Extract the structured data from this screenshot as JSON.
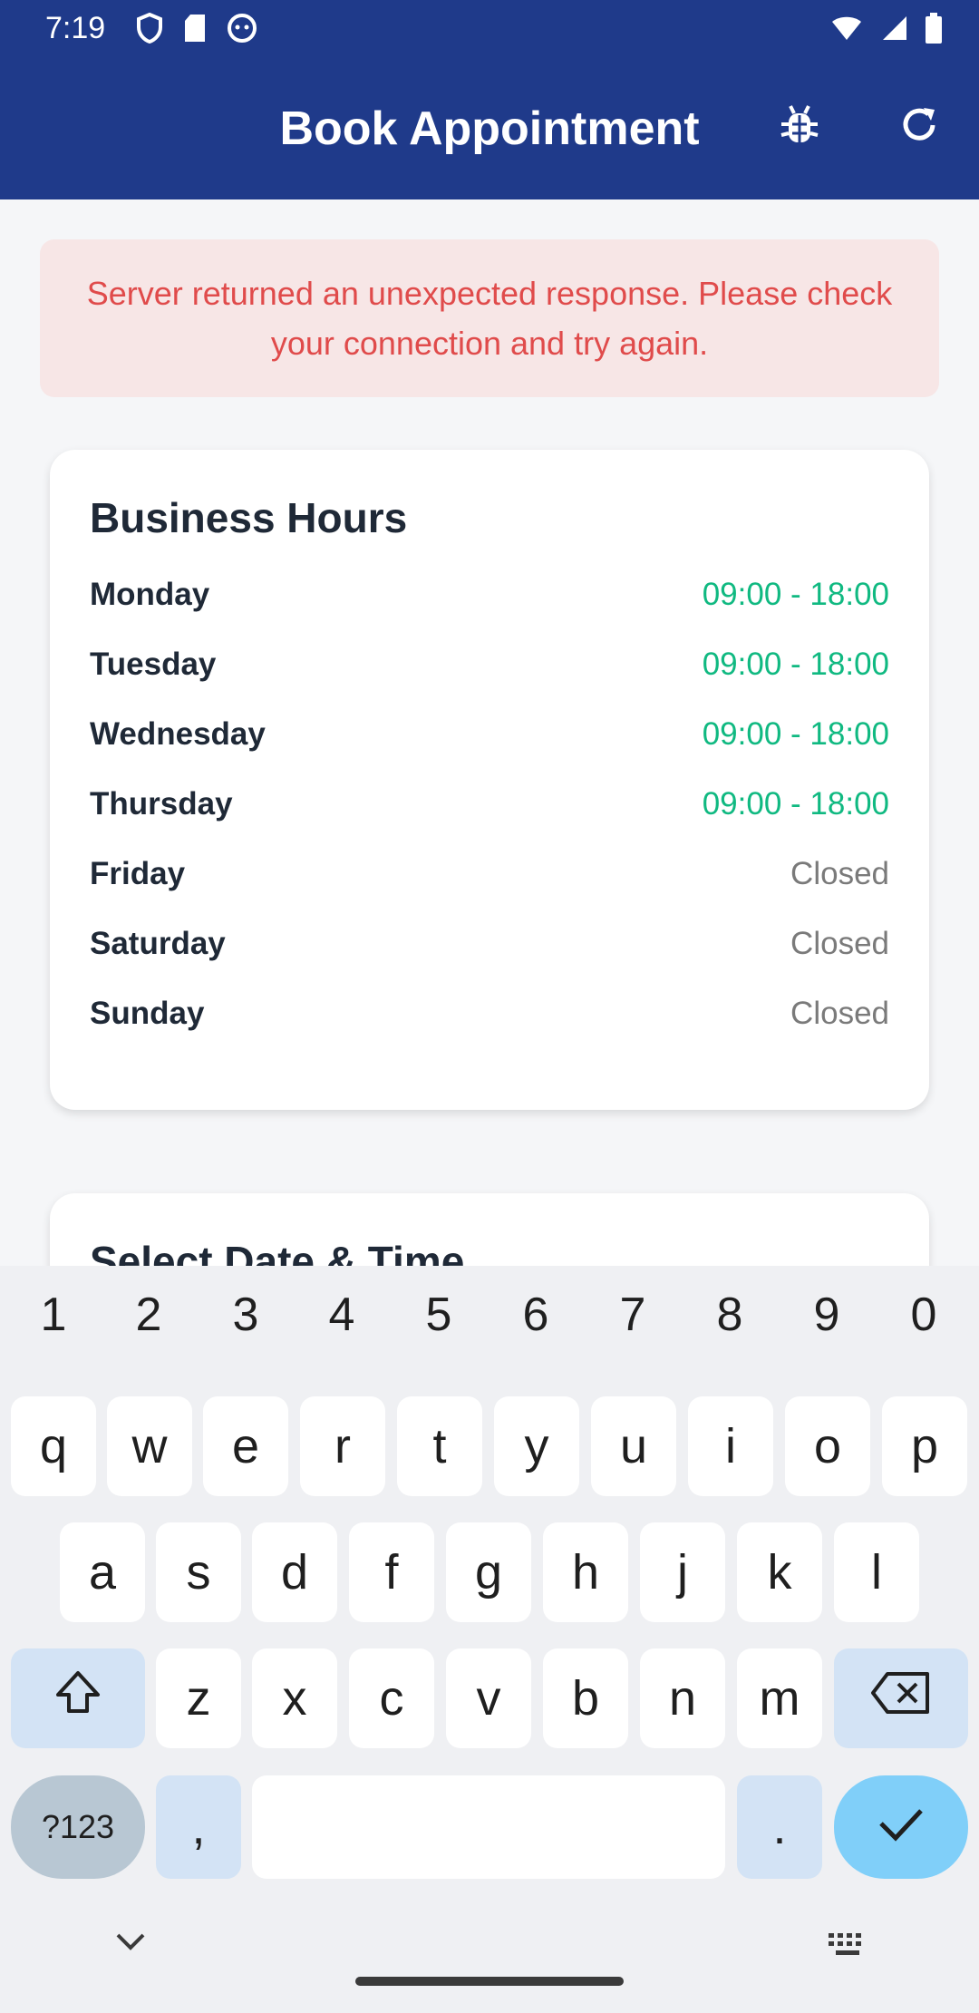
{
  "status_bar": {
    "time": "7:19"
  },
  "app_bar": {
    "title": "Book Appointment"
  },
  "error": {
    "message": "Server returned an unexpected response. Please check your connection and try again."
  },
  "hours": {
    "title": "Business Hours",
    "rows": [
      {
        "day": "Monday",
        "time": "09:00 - 18:00"
      },
      {
        "day": "Tuesday",
        "time": "09:00 - 18:00"
      },
      {
        "day": "Wednesday",
        "time": "09:00 - 18:00"
      },
      {
        "day": "Thursday",
        "time": "09:00 - 18:00"
      },
      {
        "day": "Friday",
        "time": "Closed"
      },
      {
        "day": "Saturday",
        "time": "Closed"
      },
      {
        "day": "Sunday",
        "time": "Closed"
      }
    ]
  },
  "datetime": {
    "title": "Select Date & Time"
  },
  "keyboard": {
    "numbers": [
      "1",
      "2",
      "3",
      "4",
      "5",
      "6",
      "7",
      "8",
      "9",
      "0"
    ],
    "row1": [
      "q",
      "w",
      "e",
      "r",
      "t",
      "y",
      "u",
      "i",
      "o",
      "p"
    ],
    "row2": [
      "a",
      "s",
      "d",
      "f",
      "g",
      "h",
      "j",
      "k",
      "l"
    ],
    "row3": [
      "z",
      "x",
      "c",
      "v",
      "b",
      "n",
      "m"
    ],
    "sym_label": "?123",
    "comma": ",",
    "period": "."
  },
  "colors": {
    "primary": "#1f3a8a",
    "open_time": "#10b981",
    "error": "#e04b4b"
  }
}
